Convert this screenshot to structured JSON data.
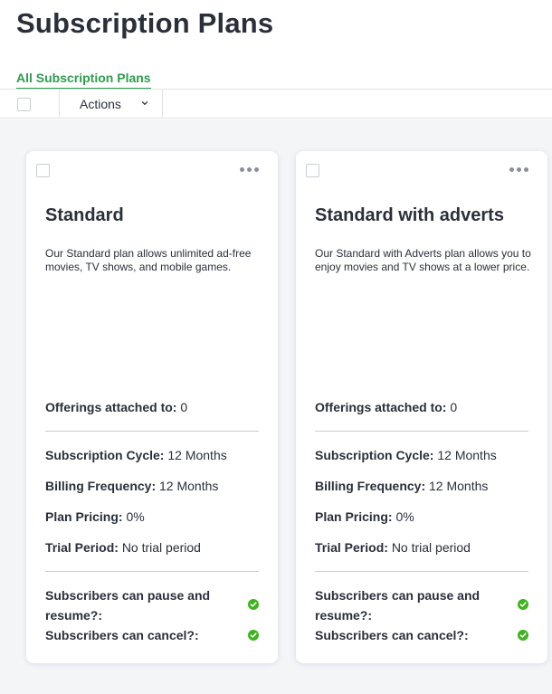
{
  "page": {
    "title": "Subscription Plans"
  },
  "tabs": [
    {
      "label": "All Subscription Plans",
      "active": true
    }
  ],
  "toolbar": {
    "actions_label": "Actions"
  },
  "labels": {
    "offerings": "Offerings attached to:",
    "cycle": "Subscription Cycle:",
    "billing": "Billing Frequency:",
    "pricing": "Plan Pricing:",
    "trial": "Trial Period:",
    "pause_resume": "Subscribers can pause and resume?:",
    "cancel": "Subscribers can cancel?:"
  },
  "plans": [
    {
      "name": "Standard",
      "description": "Our Standard plan allows unlimited ad-free movies, TV shows, and mobile games.",
      "offerings_attached": "0",
      "subscription_cycle": "12 Months",
      "billing_frequency": "12 Months",
      "plan_pricing": "0%",
      "trial_period": "No trial period",
      "can_pause_resume": true,
      "can_cancel": true
    },
    {
      "name": "Standard with adverts",
      "description": "Our Standard with Adverts plan allows you to enjoy movies and TV shows at a lower price.",
      "offerings_attached": "0",
      "subscription_cycle": "12 Months",
      "billing_frequency": "12 Months",
      "plan_pricing": "0%",
      "trial_period": "No trial period",
      "can_pause_resume": true,
      "can_cancel": true
    }
  ],
  "colors": {
    "accent": "#2e9c4f",
    "check": "#3db41f",
    "text": "#2a2f3a"
  }
}
